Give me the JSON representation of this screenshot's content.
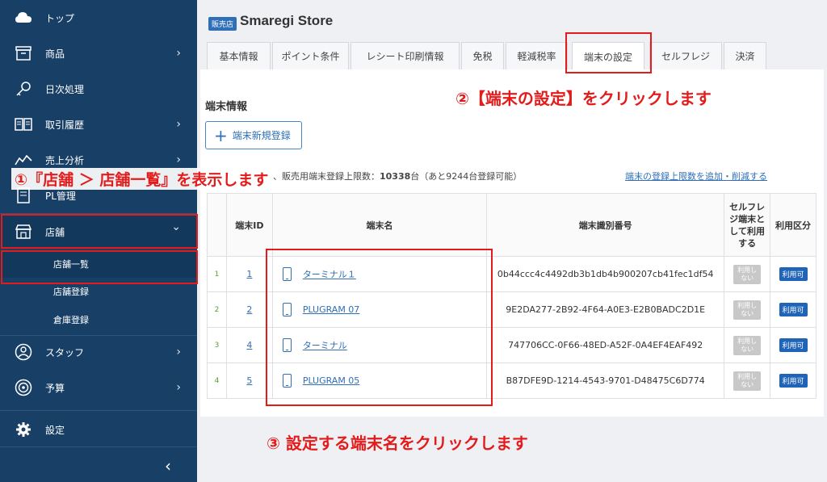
{
  "sidebar": {
    "items": [
      {
        "label": "トップ",
        "icon": "cloud-icon",
        "chevron": ""
      },
      {
        "label": "商品",
        "icon": "box-icon",
        "chevron": "›"
      },
      {
        "label": "日次処理",
        "icon": "key-icon",
        "chevron": ""
      },
      {
        "label": "取引履歴",
        "icon": "book-icon",
        "chevron": "›"
      },
      {
        "label": "売上分析",
        "icon": "chart-icon",
        "chevron": "›"
      },
      {
        "label": "PL管理",
        "icon": "report-icon",
        "chevron": ""
      },
      {
        "label": "店舗",
        "icon": "store-icon",
        "chevron": "⌄"
      },
      {
        "label": "スタッフ",
        "icon": "staff-icon",
        "chevron": "›"
      },
      {
        "label": "予算",
        "icon": "target-icon",
        "chevron": "›"
      },
      {
        "label": "設定",
        "icon": "gear-icon",
        "chevron": ""
      }
    ],
    "sub_items": [
      {
        "label": "店舗一覧"
      },
      {
        "label": "店舗登録"
      },
      {
        "label": "倉庫登録"
      }
    ],
    "collapse_chevron": "‹"
  },
  "header": {
    "badge": "販売店",
    "title": "Smaregi Store"
  },
  "tabs": [
    {
      "label": "基本情報"
    },
    {
      "label": "ポイント条件"
    },
    {
      "label": "レシート印刷情報"
    },
    {
      "label": "免税"
    },
    {
      "label": "軽減税率"
    },
    {
      "label": "端末の設定"
    },
    {
      "label": "セルフレジ"
    },
    {
      "label": "決済"
    }
  ],
  "section": {
    "title": "端末情報",
    "add_button": "端末新規登録"
  },
  "info": {
    "prefix": "、販売用端末登録上限数：",
    "limit": "10338",
    "suffix": "台（あと9244台登録可能）",
    "link": "端末の登録上限数を追加・削減する"
  },
  "table": {
    "headers": {
      "id": "端末ID",
      "name": "端末名",
      "serial": "端末識別番号",
      "self": "セルフレジ端末として利用する",
      "usage": "利用区分"
    },
    "rows": [
      {
        "num": "1",
        "id": "1",
        "name": "ターミナル１",
        "serial": "0b44ccc4c4492db3b1db4b900207cb41fec1df54",
        "self": "利用しない",
        "usage": "利用可"
      },
      {
        "num": "2",
        "id": "2",
        "name": "PLUGRAM 07",
        "serial": "9E2DA277-2B92-4F64-A0E3-E2B0BADC2D1E",
        "self": "利用しない",
        "usage": "利用可"
      },
      {
        "num": "3",
        "id": "4",
        "name": "ターミナル",
        "serial": "747706CC-0F66-48ED-A52F-0A4EF4EAF492",
        "self": "利用しない",
        "usage": "利用可"
      },
      {
        "num": "4",
        "id": "5",
        "name": "PLUGRAM 05",
        "serial": "B87DFE9D-1214-4543-9701-D48475C6D774",
        "self": "利用しない",
        "usage": "利用可"
      }
    ]
  },
  "annotations": {
    "step1": "①『店舗 ＞ 店舗一覧』を表示します",
    "step2": "②【端末の設定】をクリックします",
    "step3": "③ 設定する端末名をクリックします"
  },
  "colors": {
    "sidebar": "#183f66",
    "accent": "#2e6fb8",
    "annotation": "#e31b1b"
  }
}
